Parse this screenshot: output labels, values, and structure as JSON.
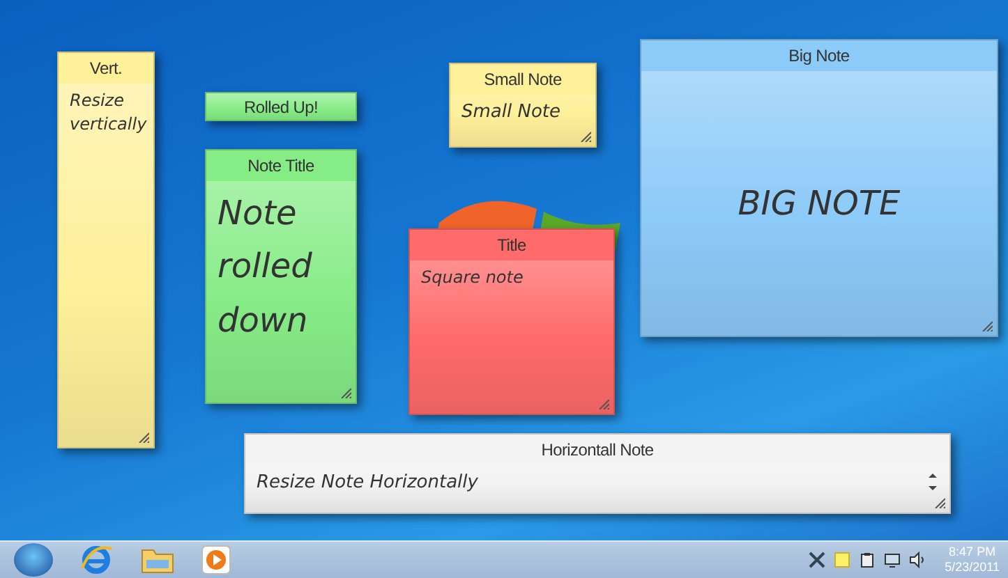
{
  "desktop": {
    "notes": [
      {
        "kind": "note",
        "title": "Vert.",
        "body": "Resize vertically",
        "color": "#fff09a"
      },
      {
        "kind": "rolled",
        "title": "Rolled Up!",
        "color": "#86ec86"
      },
      {
        "kind": "note",
        "title": "Note Title",
        "body": "Note rolled down",
        "color": "#86ec86"
      },
      {
        "kind": "note",
        "title": "Small Note",
        "body": "Small Note",
        "color": "#fff09a"
      },
      {
        "kind": "note",
        "title": "Big Note",
        "body": "BIG NOTE",
        "color": "#8ccaf8"
      },
      {
        "kind": "note",
        "title": "Title",
        "body": "Square note",
        "color": "#ff6a6a"
      },
      {
        "kind": "note",
        "title": "Horizontall Note",
        "body": "Resize Note Horizontally",
        "color": "#f4f4f4"
      }
    ]
  },
  "taskbar": {
    "clock": {
      "time": "8:47 PM",
      "date": "5/23/2011"
    }
  }
}
